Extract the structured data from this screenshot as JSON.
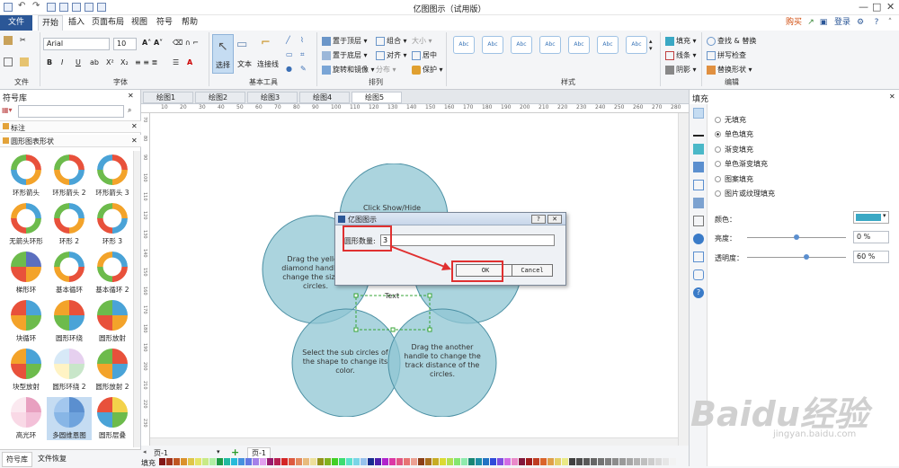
{
  "window": {
    "title": "亿图图示（试用版）"
  },
  "topright": {
    "buy": "购买",
    "login": "登录"
  },
  "tabs": [
    "文件",
    "开始",
    "插入",
    "页面布局",
    "视图",
    "符号",
    "帮助"
  ],
  "ribbon": {
    "font_name": "Arial",
    "font_size": "10",
    "groups": {
      "file": "文件",
      "font": "字体",
      "basic_tools": "基本工具",
      "arrange": "排列",
      "style": "样式",
      "edit": "编辑"
    },
    "tools": {
      "select": "选择",
      "text": "文本",
      "connector": "连接线"
    },
    "arrange_items": [
      "置于顶层",
      "组合",
      "大小",
      "置于底层",
      "对齐",
      "居中",
      "旋转和镜像",
      "分布",
      "保护"
    ],
    "style_label": "Abc",
    "fill_items": [
      "填充",
      "线条",
      "阴影"
    ],
    "edit_items": [
      "查找 & 替换",
      "拼写检查",
      "替换形状"
    ]
  },
  "library": {
    "title": "符号库",
    "sections": [
      "标注",
      "圆形图表形状"
    ],
    "items": [
      "环形箭头",
      "环形箭头 2",
      "环形箭头 3",
      "无箭头环形",
      "环形 2",
      "环形 3",
      "梯形环",
      "基本循环",
      "基本循环 2",
      "块循环",
      "圆形环绕",
      "圆形放射",
      "块型放射",
      "圆形环绕 2",
      "圆形放射 2",
      "高光环",
      "多圆维恩图",
      "圆形层叠"
    ],
    "bottom_tabs": [
      "符号库",
      "文件恢复"
    ]
  },
  "doc_tabs": [
    "绘图1",
    "绘图2",
    "绘图3",
    "绘图4",
    "绘图5"
  ],
  "ruler": [
    "10",
    "20",
    "30",
    "40",
    "50",
    "60",
    "70",
    "80",
    "90",
    "100",
    "110",
    "120",
    "130",
    "140",
    "150",
    "160",
    "170",
    "180",
    "190",
    "200",
    "210",
    "220",
    "230",
    "240",
    "250",
    "260",
    "270",
    "280"
  ],
  "ruler_v": [
    "70",
    "80",
    "90",
    "100",
    "110",
    "120",
    "130",
    "140",
    "150",
    "160",
    "170",
    "180",
    "190",
    "200",
    "210",
    "220",
    "230"
  ],
  "diagram": {
    "top": "Click Show/Hide",
    "left": "Drag the yellow diamond handle to change the size of circles.",
    "center": "Text",
    "bottom_left": "Select the sub circles of the shape to change its color.",
    "bottom_right": "Drag the another handle to change the track distance of the circles."
  },
  "dialog": {
    "title": "亿图图示",
    "label": "圆形数量:",
    "value": "3",
    "ok": "OK",
    "cancel": "Cancel",
    "help": "?"
  },
  "fill_panel": {
    "title": "填充",
    "options": [
      "无填充",
      "单色填充",
      "渐变填充",
      "单色渐变填充",
      "图案填充",
      "图片或纹理填充"
    ],
    "color_label": "颜色：",
    "brightness_label": "亮度：",
    "brightness": "0 %",
    "brightness_level": 0.5,
    "transparency_label": "透明度：",
    "transparency": "60 %",
    "transparency_level": 0.6
  },
  "status": {
    "page_left": "页-1",
    "page_tab": "页-1",
    "fill": "填充"
  },
  "colors": {
    "accent": "#2b5797",
    "circle": "#8fc6d3",
    "circle_stroke": "#4a8fa3",
    "swatch": "#3aa8c4"
  },
  "watermark": "Baidu经验",
  "watermark_url": "jingyan.baidu.com"
}
